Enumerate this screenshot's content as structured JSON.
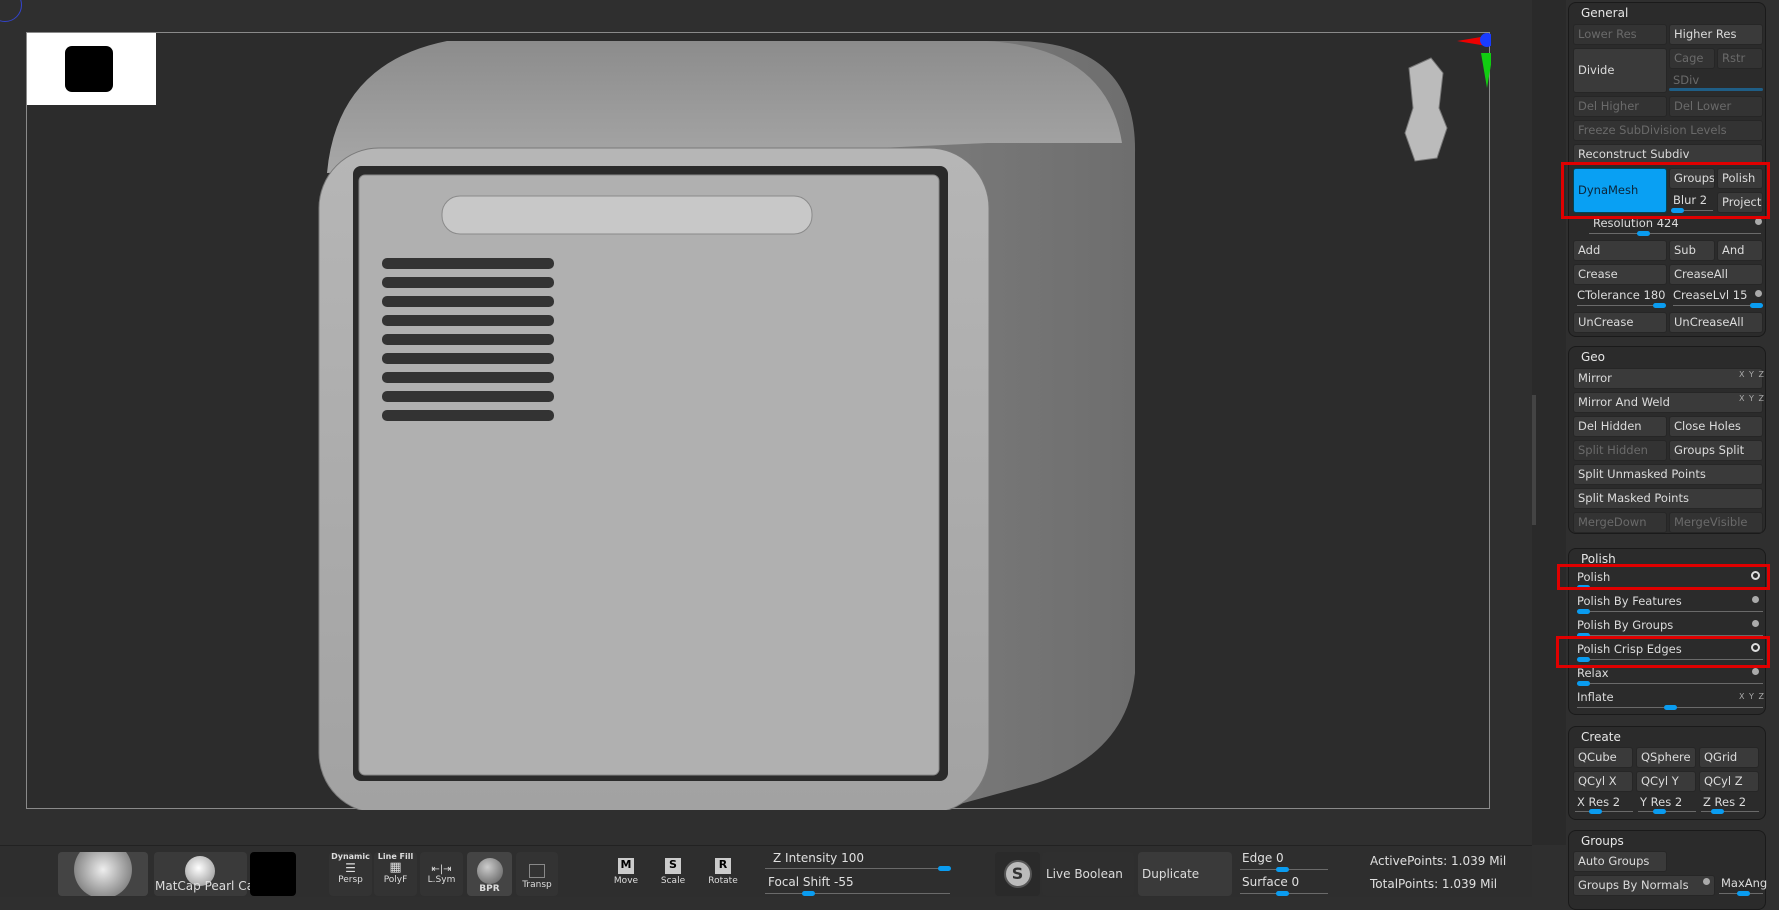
{
  "viewport": {
    "thumbnail": "mesh-thumbnail"
  },
  "general": {
    "title": "General",
    "lower_res": "Lower Res",
    "higher_res": "Higher Res",
    "divide": "Divide",
    "cage": "Cage",
    "rstr": "Rstr",
    "sdiv": "SDiv",
    "del_higher": "Del Higher",
    "del_lower": "Del Lower",
    "freeze": "Freeze SubDivision Levels",
    "reconstruct": "Reconstruct Subdiv",
    "dynamesh": "DynaMesh",
    "groups": "Groups",
    "polish": "Polish",
    "blur": "Blur 2",
    "project": "Project",
    "resolution": "Resolution 424",
    "resolution_value": 424,
    "add": "Add",
    "sub": "Sub",
    "and": "And",
    "crease": "Crease",
    "creaseall": "CreaseAll",
    "ctolerance": "CTolerance 180",
    "creaselvl": "CreaseLvl 15",
    "uncrease": "UnCrease",
    "uncreaseall": "UnCreaseAll"
  },
  "geo": {
    "title": "Geo",
    "mirror": "Mirror",
    "mirror_weld": "Mirror And Weld",
    "xyz": "X Y Z",
    "del_hidden": "Del Hidden",
    "close_holes": "Close Holes",
    "split_hidden": "Split Hidden",
    "groups_split": "Groups Split",
    "split_unmasked": "Split Unmasked Points",
    "split_masked": "Split Masked Points",
    "merge_down": "MergeDown",
    "merge_visible": "MergeVisible"
  },
  "polish": {
    "title": "Polish",
    "items": [
      "Polish",
      "Polish By Features",
      "Polish By Groups",
      "Polish Crisp Edges",
      "Relax",
      "Inflate"
    ]
  },
  "create": {
    "title": "Create",
    "qcube": "QCube",
    "qsphere": "QSphere",
    "qgrid": "QGrid",
    "qcylx": "QCyl X",
    "qcyly": "QCyl Y",
    "qcylz": "QCyl Z",
    "xres": "X Res 2",
    "yres": "Y Res 2",
    "zres": "Z Res 2"
  },
  "groups": {
    "title": "Groups",
    "auto_groups": "Auto Groups",
    "by_normals": "Groups By Normals",
    "maxang": "MaxAng"
  },
  "bottom": {
    "material": "MatCap Pearl Ca",
    "persp_top": "Dynamic",
    "persp": "Persp",
    "polyf_top": "Line Fill",
    "polyf": "PolyF",
    "lsym": "L.Sym",
    "bpr": "BPR",
    "transp": "Transp",
    "move": "Move",
    "scale": "Scale",
    "rotate": "Rotate",
    "move_key": "M",
    "scale_key": "S",
    "rotate_key": "R",
    "z_intensity": "Z Intensity 100",
    "focal_shift": "Focal Shift -55",
    "live_boolean": "Live Boolean",
    "duplicate": "Duplicate",
    "edge": "Edge 0",
    "surface": "Surface 0",
    "active_points": "ActivePoints: 1.039 Mil",
    "total_points": "TotalPoints: 1.039 Mil"
  },
  "colors": {
    "accent": "#09a0f3",
    "highlight": "#e00000"
  }
}
